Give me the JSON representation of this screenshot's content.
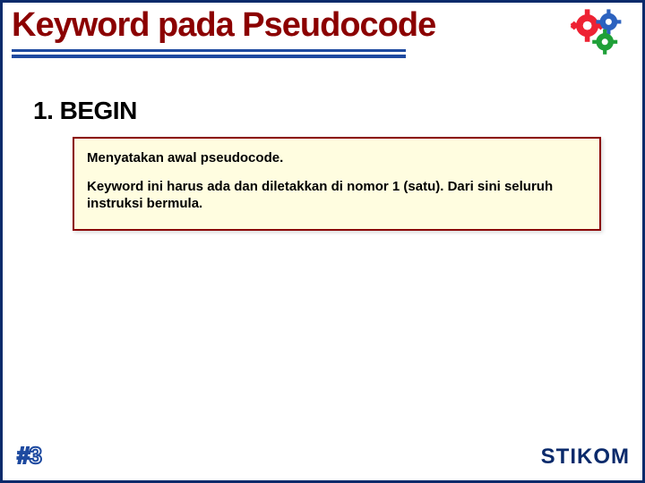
{
  "title": "Keyword pada Pseudocode",
  "subheader": "1. BEGIN",
  "box": {
    "line1": "Menyatakan awal pseudocode.",
    "line2": "Keyword ini harus ada dan diletakkan di nomor 1 (satu). Dari sini seluruh instruksi bermula."
  },
  "footer": {
    "left": "#3",
    "right": "STIKOM"
  },
  "icon": "gears-icon"
}
